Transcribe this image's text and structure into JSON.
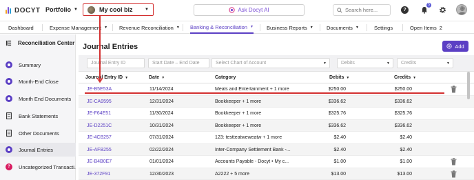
{
  "topbar": {
    "logo_text": "DOCYT",
    "portfolio_label": "Portfolio",
    "business_name": "My cool biz",
    "ask_ai_label": "Ask Docyt AI",
    "search_placeholder": "Search here...",
    "notification_count": "5"
  },
  "nav": {
    "items": [
      {
        "label": "Dashboard"
      },
      {
        "label": "Expense Management"
      },
      {
        "label": "Revenue Reconciliation"
      },
      {
        "label": "Banking & Reconciliation"
      },
      {
        "label": "Business Reports"
      },
      {
        "label": "Documents"
      },
      {
        "label": "Settings"
      },
      {
        "label": "Open Items"
      }
    ],
    "open_items_count": "2",
    "active": "Banking & Reconciliation"
  },
  "sidebar": {
    "title": "Reconciliation Center",
    "items": [
      {
        "label": "Summary"
      },
      {
        "label": "Month-End Close"
      },
      {
        "label": "Month End Documents"
      },
      {
        "label": "Bank Statements"
      },
      {
        "label": "Other Documents"
      },
      {
        "label": "Journal Entries"
      },
      {
        "label": "Uncategorized Transacti..."
      }
    ],
    "uncategorized_badge": "?",
    "active": "Journal Entries"
  },
  "main": {
    "title": "Journal Entries",
    "add_label": "Add",
    "filters": {
      "id_placeholder": "Journal Entry ID",
      "date_placeholder": "Start Date – End Date",
      "account_placeholder": "Select Chart of Account",
      "debits_placeholder": "Debits",
      "credits_placeholder": "Credits"
    },
    "columns": {
      "id": "Journal Entry ID",
      "date": "Date",
      "category": "Category",
      "debits": "Debits",
      "credits": "Credits"
    },
    "rows": [
      {
        "id": "JE-B5E53A",
        "date": "11/14/2024",
        "category": "Meals and Entertainment + 1 more",
        "debits": "$250.00",
        "credits": "$250.00"
      },
      {
        "id": "JE-CA9595",
        "date": "12/31/2024",
        "category": "Bookkeeper + 1 more",
        "debits": "$336.62",
        "credits": "$336.62"
      },
      {
        "id": "JE-F64E51",
        "date": "11/30/2024",
        "category": "Bookkeeper + 1 more",
        "debits": "$325.76",
        "credits": "$325.76"
      },
      {
        "id": "JE-D2251C",
        "date": "10/31/2024",
        "category": "Bookkeeper + 1 more",
        "debits": "$336.62",
        "credits": "$336.62"
      },
      {
        "id": "JE-4CB257",
        "date": "07/31/2024",
        "category": "123: testteatweweatw + 1 more",
        "debits": "$2.40",
        "credits": "$2.40"
      },
      {
        "id": "JE-AFB255",
        "date": "02/22/2024",
        "category": "Inter-Company Settlement Bank -...",
        "debits": "$2.40",
        "credits": "$2.40"
      },
      {
        "id": "JE-B4B0E7",
        "date": "01/01/2024",
        "category": "Accounts Payable - Docyt • My c...",
        "debits": "$1.00",
        "credits": "$1.00"
      },
      {
        "id": "JE-372F91",
        "date": "12/30/2023",
        "category": "A2222 + 5 more",
        "debits": "$13.00",
        "credits": "$13.00"
      }
    ]
  },
  "colors": {
    "accent": "#5b3fc4",
    "highlight": "#d32f2f",
    "notification": "#5b5bd6",
    "sidebar_bg": "#f5f5f7"
  }
}
